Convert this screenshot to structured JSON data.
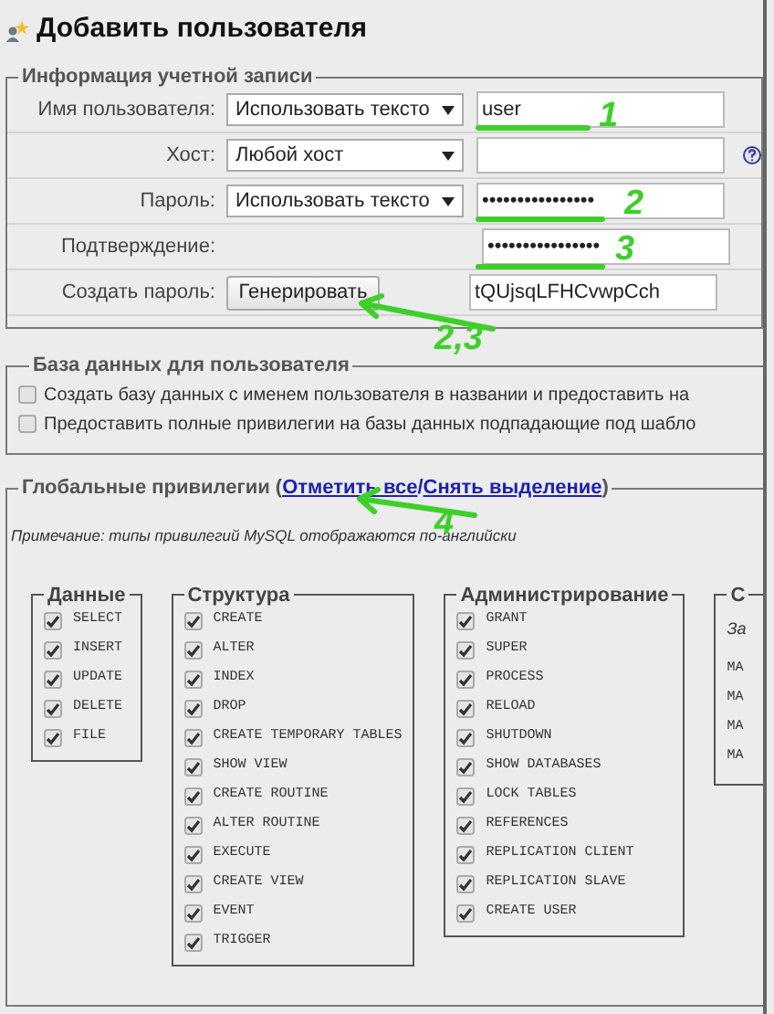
{
  "title": "Добавить пользователя",
  "account": {
    "legend": "Информация учетной записи",
    "rows": [
      {
        "kind": "select-input",
        "label": "Имя пользователя:",
        "select": "Использовать тексто",
        "value": "user"
      },
      {
        "kind": "select-input",
        "label": "Хост:",
        "select": "Любой хост",
        "value": "",
        "help": true
      },
      {
        "kind": "select-input",
        "label": "Пароль:",
        "select": "Использовать тексто",
        "value": "••••••••••••••••"
      },
      {
        "kind": "input",
        "label": "Подтверждение:",
        "value": "••••••••••••••••"
      },
      {
        "kind": "button-input",
        "label": "Создать пароль:",
        "button": "Генерировать",
        "value": "tQUjsqLFHCvwpCch"
      }
    ]
  },
  "database": {
    "legend": "База данных для пользователя",
    "options": [
      {
        "label": "Создать базу данных с именем пользователя в названии и предоставить на",
        "checked": false
      },
      {
        "label": "Предоставить полные привилегии на базы данных подпадающие под шабло",
        "checked": false
      }
    ]
  },
  "global": {
    "legend": "Глобальные привилегии (",
    "check_all": "Отметить все",
    "separator": " /",
    "uncheck_all": "Снять выделение",
    "legend_end": ")",
    "note": "Примечание: типы привилегий MySQL отображаются по-английски",
    "groups": [
      {
        "kind": "checks",
        "legend": "Данные",
        "items": [
          {
            "label": "SELECT",
            "checked": true
          },
          {
            "label": "INSERT",
            "checked": true
          },
          {
            "label": "UPDATE",
            "checked": true
          },
          {
            "label": "DELETE",
            "checked": true
          },
          {
            "label": "FILE",
            "checked": true
          }
        ]
      },
      {
        "kind": "checks",
        "legend": "Структура",
        "items": [
          {
            "label": "CREATE",
            "checked": true
          },
          {
            "label": "ALTER",
            "checked": true
          },
          {
            "label": "INDEX",
            "checked": true
          },
          {
            "label": "DROP",
            "checked": true
          },
          {
            "label": "CREATE TEMPORARY TABLES",
            "checked": true
          },
          {
            "label": "SHOW VIEW",
            "checked": true
          },
          {
            "label": "CREATE ROUTINE",
            "checked": true
          },
          {
            "label": "ALTER ROUTINE",
            "checked": true
          },
          {
            "label": "EXECUTE",
            "checked": true
          },
          {
            "label": "CREATE VIEW",
            "checked": true
          },
          {
            "label": "EVENT",
            "checked": true
          },
          {
            "label": "TRIGGER",
            "checked": true
          }
        ]
      },
      {
        "kind": "checks",
        "legend": "Администрирование",
        "items": [
          {
            "label": "GRANT",
            "checked": true
          },
          {
            "label": "SUPER",
            "checked": true
          },
          {
            "label": "PROCESS",
            "checked": true
          },
          {
            "label": "RELOAD",
            "checked": true
          },
          {
            "label": "SHUTDOWN",
            "checked": true
          },
          {
            "label": "SHOW DATABASES",
            "checked": true
          },
          {
            "label": "LOCK TABLES",
            "checked": true
          },
          {
            "label": "REFERENCES",
            "checked": true
          },
          {
            "label": "REPLICATION CLIENT",
            "checked": true
          },
          {
            "label": "REPLICATION SLAVE",
            "checked": true
          },
          {
            "label": "CREATE USER",
            "checked": true
          }
        ]
      },
      {
        "kind": "limits",
        "legend": "С",
        "note": "За",
        "lines": [
          "MA",
          "MA",
          "MA",
          "MA"
        ]
      }
    ]
  },
  "annotations": [
    {
      "kind": "underline",
      "number": "1"
    },
    {
      "kind": "underline",
      "number": "2"
    },
    {
      "kind": "underline",
      "number": "3"
    },
    {
      "kind": "arrow",
      "number": "2,3"
    },
    {
      "kind": "arrow",
      "number": "4"
    }
  ]
}
